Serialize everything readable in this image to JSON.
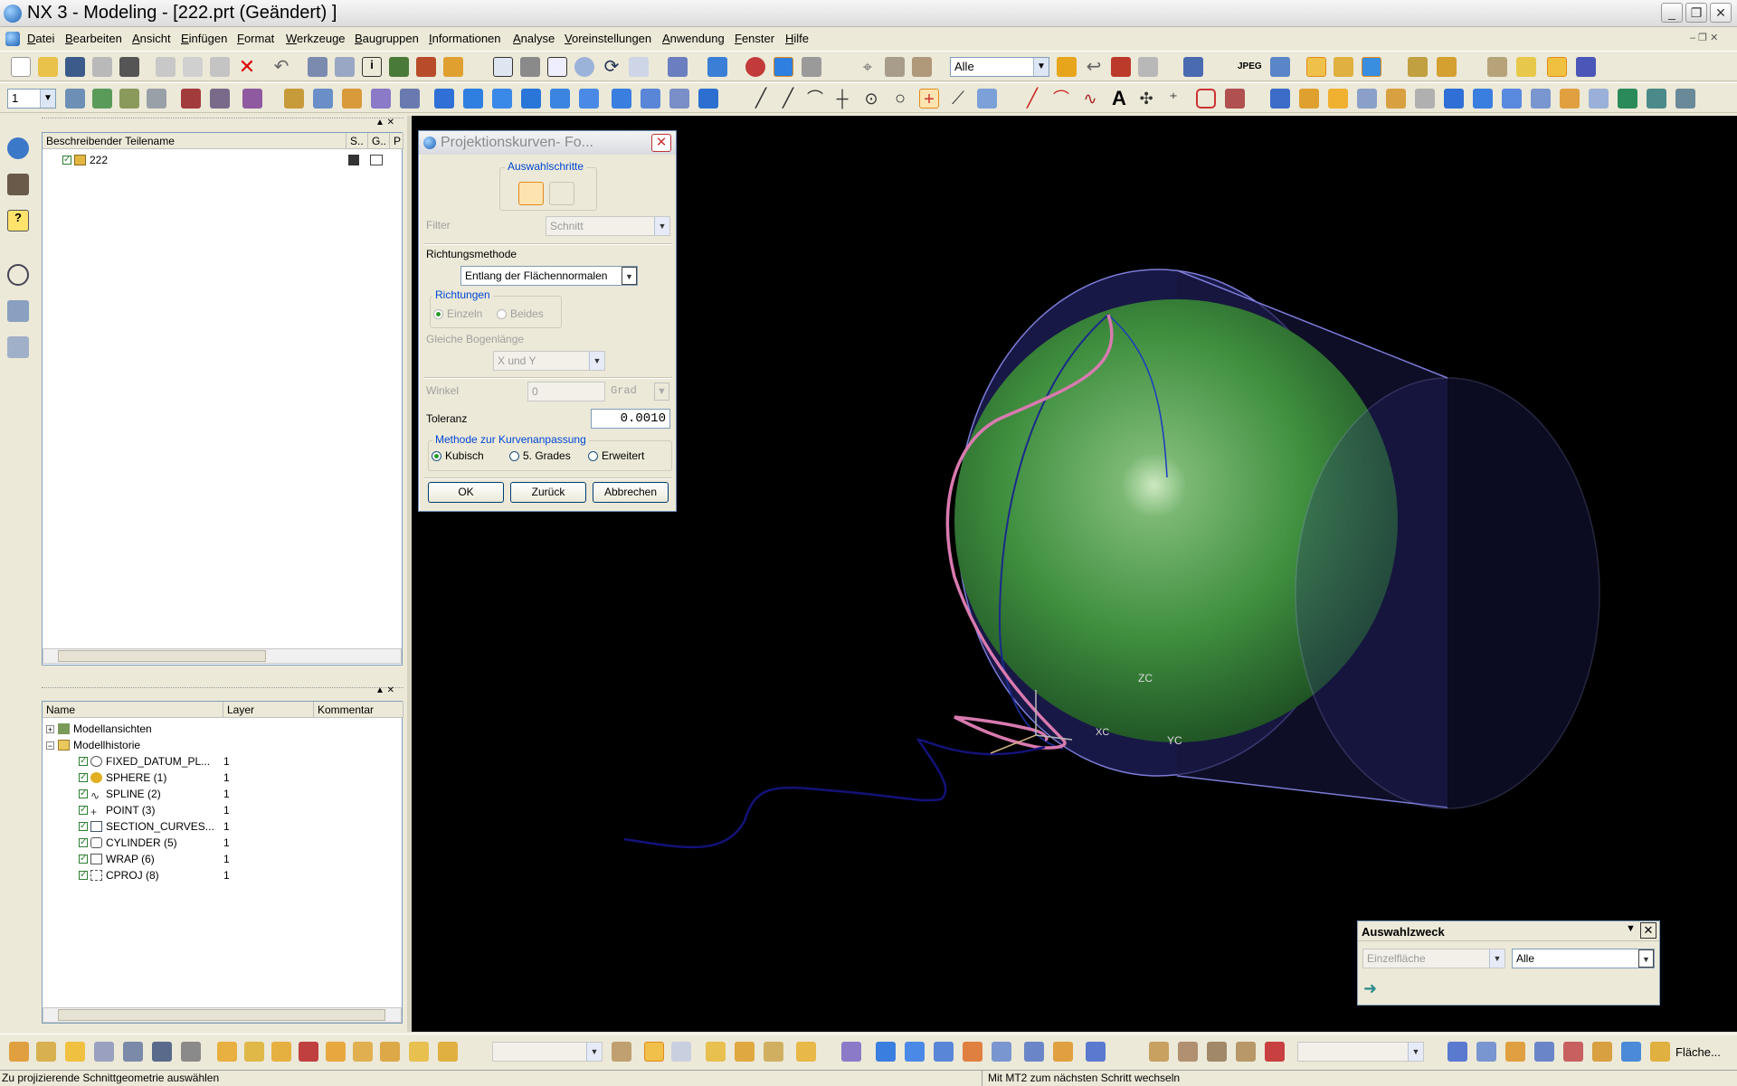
{
  "window": {
    "title": "NX 3 - Modeling - [222.prt (Geändert) ]",
    "controls": [
      "_",
      "❐",
      "✕"
    ]
  },
  "menu": [
    "Datei",
    "Bearbeiten",
    "Ansicht",
    "Einfügen",
    "Format",
    "Werkzeuge",
    "Baugruppen",
    "Informationen",
    "Analyse",
    "Voreinstellungen",
    "Anwendung",
    "Fenster",
    "Hilfe"
  ],
  "toolbar": {
    "filter_value": "Alle",
    "jpeg_label": "JPEG",
    "layer_value": "1"
  },
  "part_navigator": {
    "col_name": "Beschreibender Teilename",
    "col_s": "S..",
    "col_g": "G..",
    "col_p": "P",
    "part": "222"
  },
  "model_navigator": {
    "col_name": "Name",
    "col_layer": "Layer",
    "col_comment": "Kommentar",
    "groups": [
      "Modellansichten",
      "Modellhistorie"
    ],
    "features": [
      {
        "name": "FIXED_DATUM_PL...",
        "layer": "1"
      },
      {
        "name": "SPHERE (1)",
        "layer": "1"
      },
      {
        "name": "SPLINE (2)",
        "layer": "1"
      },
      {
        "name": "POINT (3)",
        "layer": "1"
      },
      {
        "name": "SECTION_CURVES...",
        "layer": "1"
      },
      {
        "name": "CYLINDER (5)",
        "layer": "1"
      },
      {
        "name": "WRAP (6)",
        "layer": "1"
      },
      {
        "name": "CPROJ (8)",
        "layer": "1"
      }
    ]
  },
  "dialog": {
    "title": "Projektionskurven- Fo...",
    "steps_group": "Auswahlschritte",
    "filter_label": "Filter",
    "filter_value": "Schnitt",
    "direction_method_label": "Richtungsmethode",
    "direction_method_value": "Entlang der Flächennormalen",
    "directions_group": "Richtungen",
    "dir_single": "Einzeln",
    "dir_both": "Beides",
    "arc_length_label": "Gleiche Bogenlänge",
    "arc_length_value": "X und Y",
    "angle_label": "Winkel",
    "angle_value": "0",
    "angle_unit": "Grad",
    "tolerance_label": "Toleranz",
    "tolerance_value": "0.0010",
    "fit_group": "Methode zur Kurvenanpassung",
    "fit_cubic": "Kubisch",
    "fit_quintic": "5. Grades",
    "fit_advanced": "Erweitert",
    "ok": "OK",
    "back": "Zurück",
    "cancel": "Abbrechen"
  },
  "viewport": {
    "axis_z": "ZC",
    "axis_y": "YC",
    "axis_x": "XC"
  },
  "selection_intent": {
    "title": "Auswahlzweck",
    "rule_value": "Einzelfläche",
    "scope_value": "Alle"
  },
  "bottombar": {
    "more_label": "Fläche..."
  },
  "status": {
    "left": "Zu projizierende Schnittgeometrie auswählen",
    "right": "Mit MT2 zum nächsten Schritt wechseln"
  },
  "colors": {
    "viewport_bg": "#000000",
    "sphere": "#3f8f3f",
    "cylinder_edge": "#7c7cd8",
    "projected_curve": "#d97ab0",
    "spline": "#13127a",
    "group_title": "#0046d5"
  }
}
